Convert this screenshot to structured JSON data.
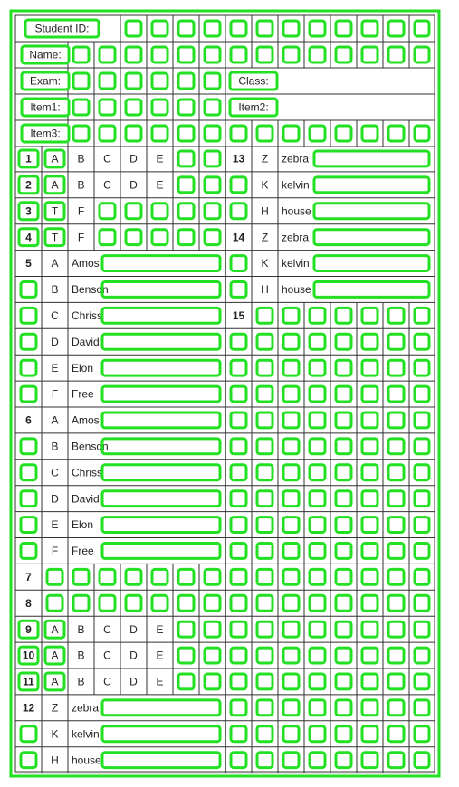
{
  "colors": {
    "grid": "#333333",
    "box": "#22e022",
    "text": "#222222"
  },
  "header": {
    "student_id": "Student ID:",
    "name": "Name:",
    "exam": "Exam:",
    "class": "Class:",
    "item1": "Item1:",
    "item2": "Item2:",
    "item3": "Item3:"
  },
  "rows": [
    {
      "left": [
        "1",
        "A",
        "B",
        "C",
        "D",
        "E"
      ],
      "right": [
        "13",
        "Z",
        "zebra"
      ]
    },
    {
      "left": [
        "2",
        "A",
        "B",
        "C",
        "D",
        "E"
      ],
      "right": [
        "",
        "K",
        "kelvin"
      ]
    },
    {
      "left": [
        "3",
        "T",
        "F"
      ],
      "right": [
        "",
        "H",
        "house"
      ]
    },
    {
      "left": [
        "4",
        "T",
        "F"
      ],
      "right": [
        "14",
        "Z",
        "zebra"
      ]
    },
    {
      "left": [
        "5",
        "A",
        "Amos"
      ],
      "right": [
        "",
        "K",
        "kelvin"
      ]
    },
    {
      "left": [
        "",
        "B",
        "Benson"
      ],
      "right": [
        "",
        "H",
        "house"
      ]
    },
    {
      "left": [
        "",
        "C",
        "Chriss"
      ],
      "right": [
        "15"
      ]
    },
    {
      "left": [
        "",
        "D",
        "David"
      ],
      "right": []
    },
    {
      "left": [
        "",
        "E",
        "Elon"
      ],
      "right": []
    },
    {
      "left": [
        "",
        "F",
        "Free"
      ],
      "right": []
    },
    {
      "left": [
        "6",
        "A",
        "Amos"
      ],
      "right": []
    },
    {
      "left": [
        "",
        "B",
        "Benson"
      ],
      "right": []
    },
    {
      "left": [
        "",
        "C",
        "Chriss"
      ],
      "right": []
    },
    {
      "left": [
        "",
        "D",
        "David"
      ],
      "right": []
    },
    {
      "left": [
        "",
        "E",
        "Elon"
      ],
      "right": []
    },
    {
      "left": [
        "",
        "F",
        "Free"
      ],
      "right": []
    },
    {
      "left": [
        "7"
      ],
      "right": []
    },
    {
      "left": [
        "8"
      ],
      "right": []
    },
    {
      "left": [
        "9",
        "A",
        "B",
        "C",
        "D",
        "E"
      ],
      "right": []
    },
    {
      "left": [
        "10",
        "A",
        "B",
        "C",
        "D",
        "E"
      ],
      "right": []
    },
    {
      "left": [
        "11",
        "A",
        "B",
        "C",
        "D",
        "E"
      ],
      "right": []
    },
    {
      "left": [
        "12",
        "Z",
        "zebra"
      ],
      "right": []
    },
    {
      "left": [
        "",
        "K",
        "kelvin"
      ],
      "right": []
    },
    {
      "left": [
        "",
        "H",
        "house"
      ],
      "right": []
    }
  ]
}
